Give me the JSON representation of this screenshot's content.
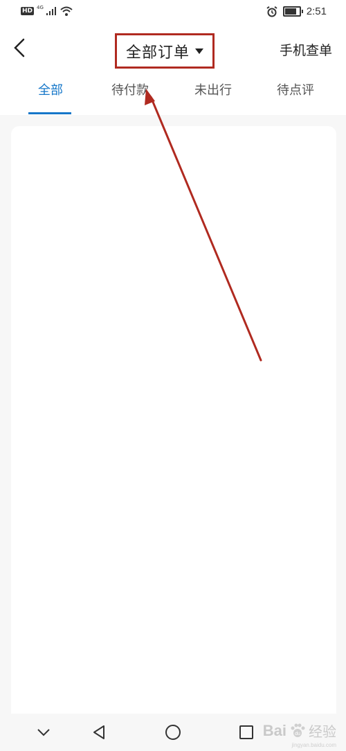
{
  "status_bar": {
    "hd": "HD",
    "network": "4G",
    "time": "2:51",
    "battery_level": 0.8
  },
  "header": {
    "title": "全部订单",
    "right_action": "手机查单"
  },
  "tabs": [
    {
      "label": "全部",
      "active": true
    },
    {
      "label": "待付款",
      "active": false
    },
    {
      "label": "未出行",
      "active": false
    },
    {
      "label": "待点评",
      "active": false
    }
  ],
  "colors": {
    "accent": "#1677c9",
    "annotation": "#b02a20",
    "background": "#f7f7f7"
  },
  "watermark": {
    "brand": "Bai",
    "paw": "du",
    "sub": "经验",
    "url": "jingyan.baidu.com"
  },
  "icons": {
    "back": "chevron-left-icon",
    "caret": "caret-down-icon",
    "nav_down": "chevron-down-icon",
    "nav_back": "triangle-back-icon",
    "nav_home": "circle-home-icon",
    "nav_recent": "square-recent-icon"
  }
}
